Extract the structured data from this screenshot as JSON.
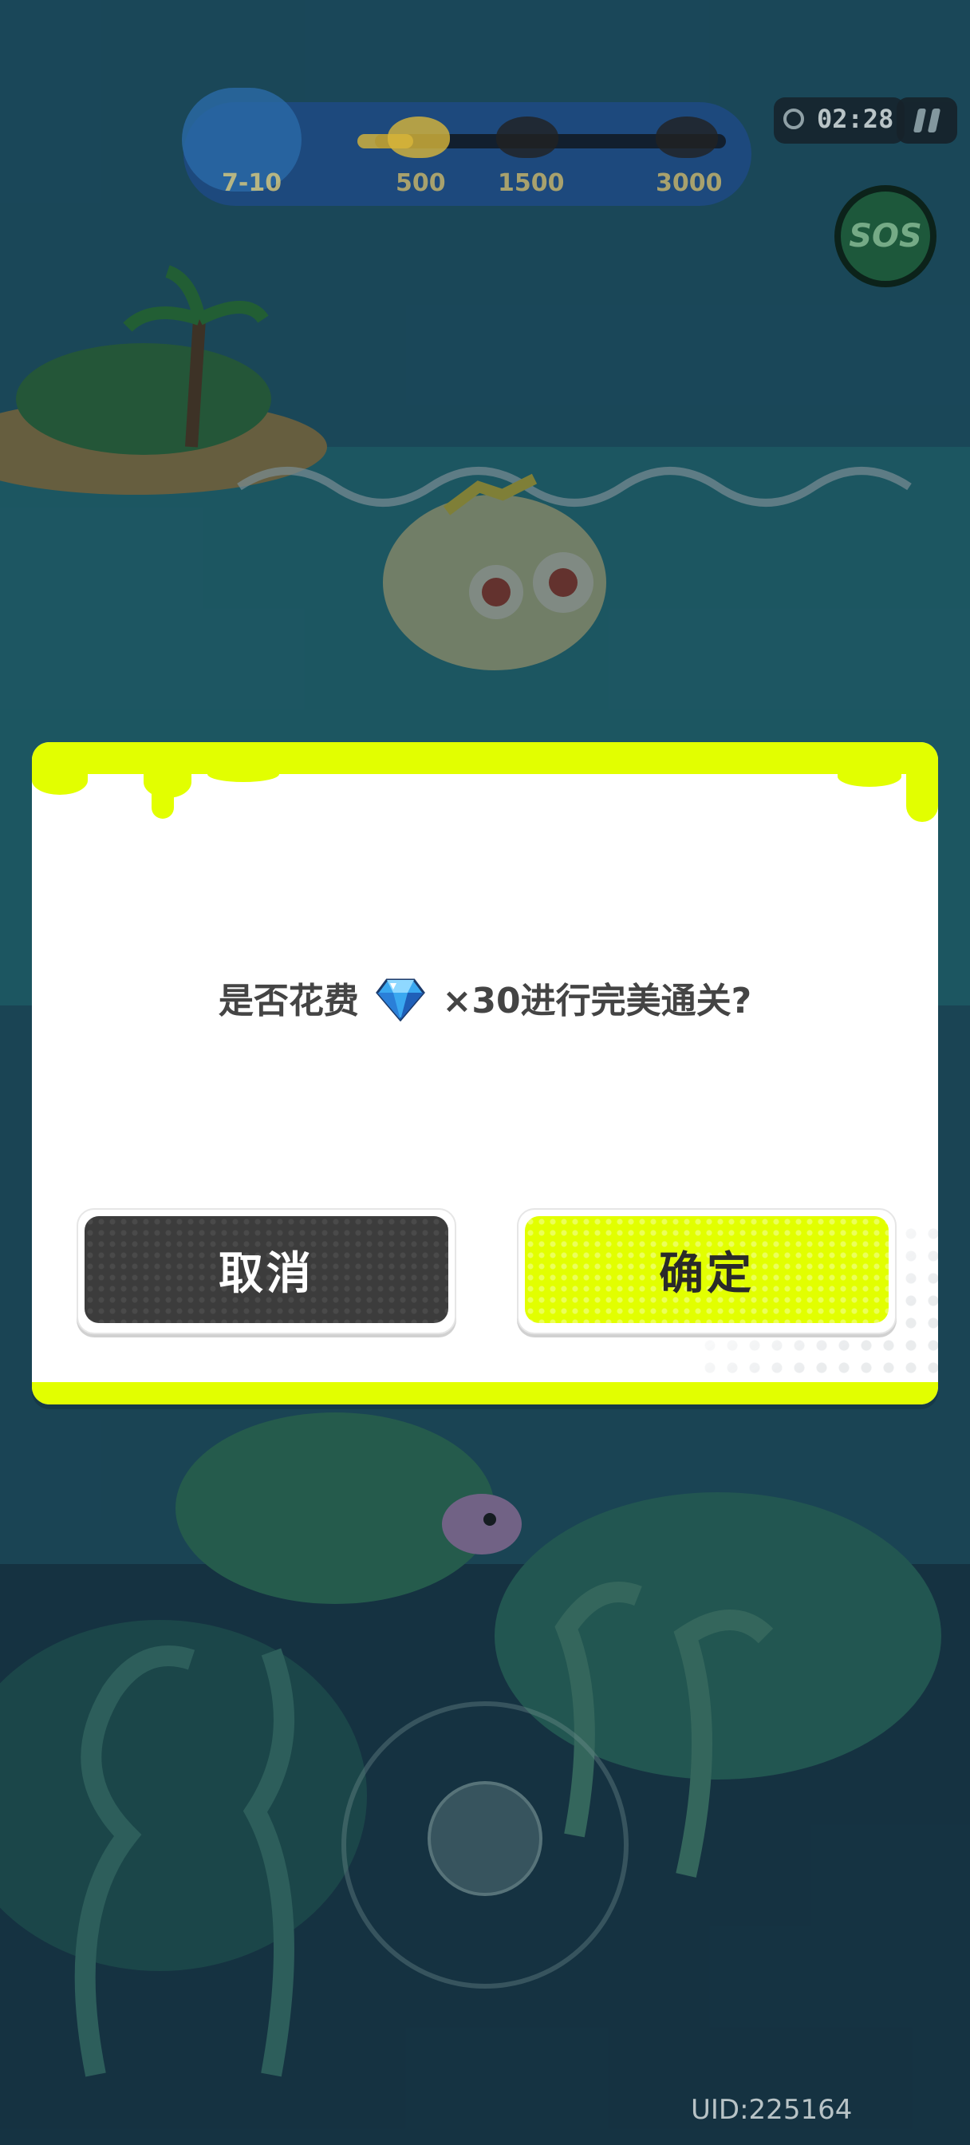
{
  "hud": {
    "level": "7-10",
    "milestones": [
      "500",
      "1500",
      "3000"
    ],
    "timer": "02:28"
  },
  "sos_label": "SOS",
  "dialog": {
    "question_before": "是否花费",
    "question_after": "×30进行完美通关?",
    "cost": 30,
    "cancel_label": "取消",
    "confirm_label": "确定"
  },
  "uid": "UID:225164",
  "colors": {
    "accent": "#e2ff00",
    "cancel_button": "#3c3c3c",
    "dialog_background": "#ffffff"
  }
}
